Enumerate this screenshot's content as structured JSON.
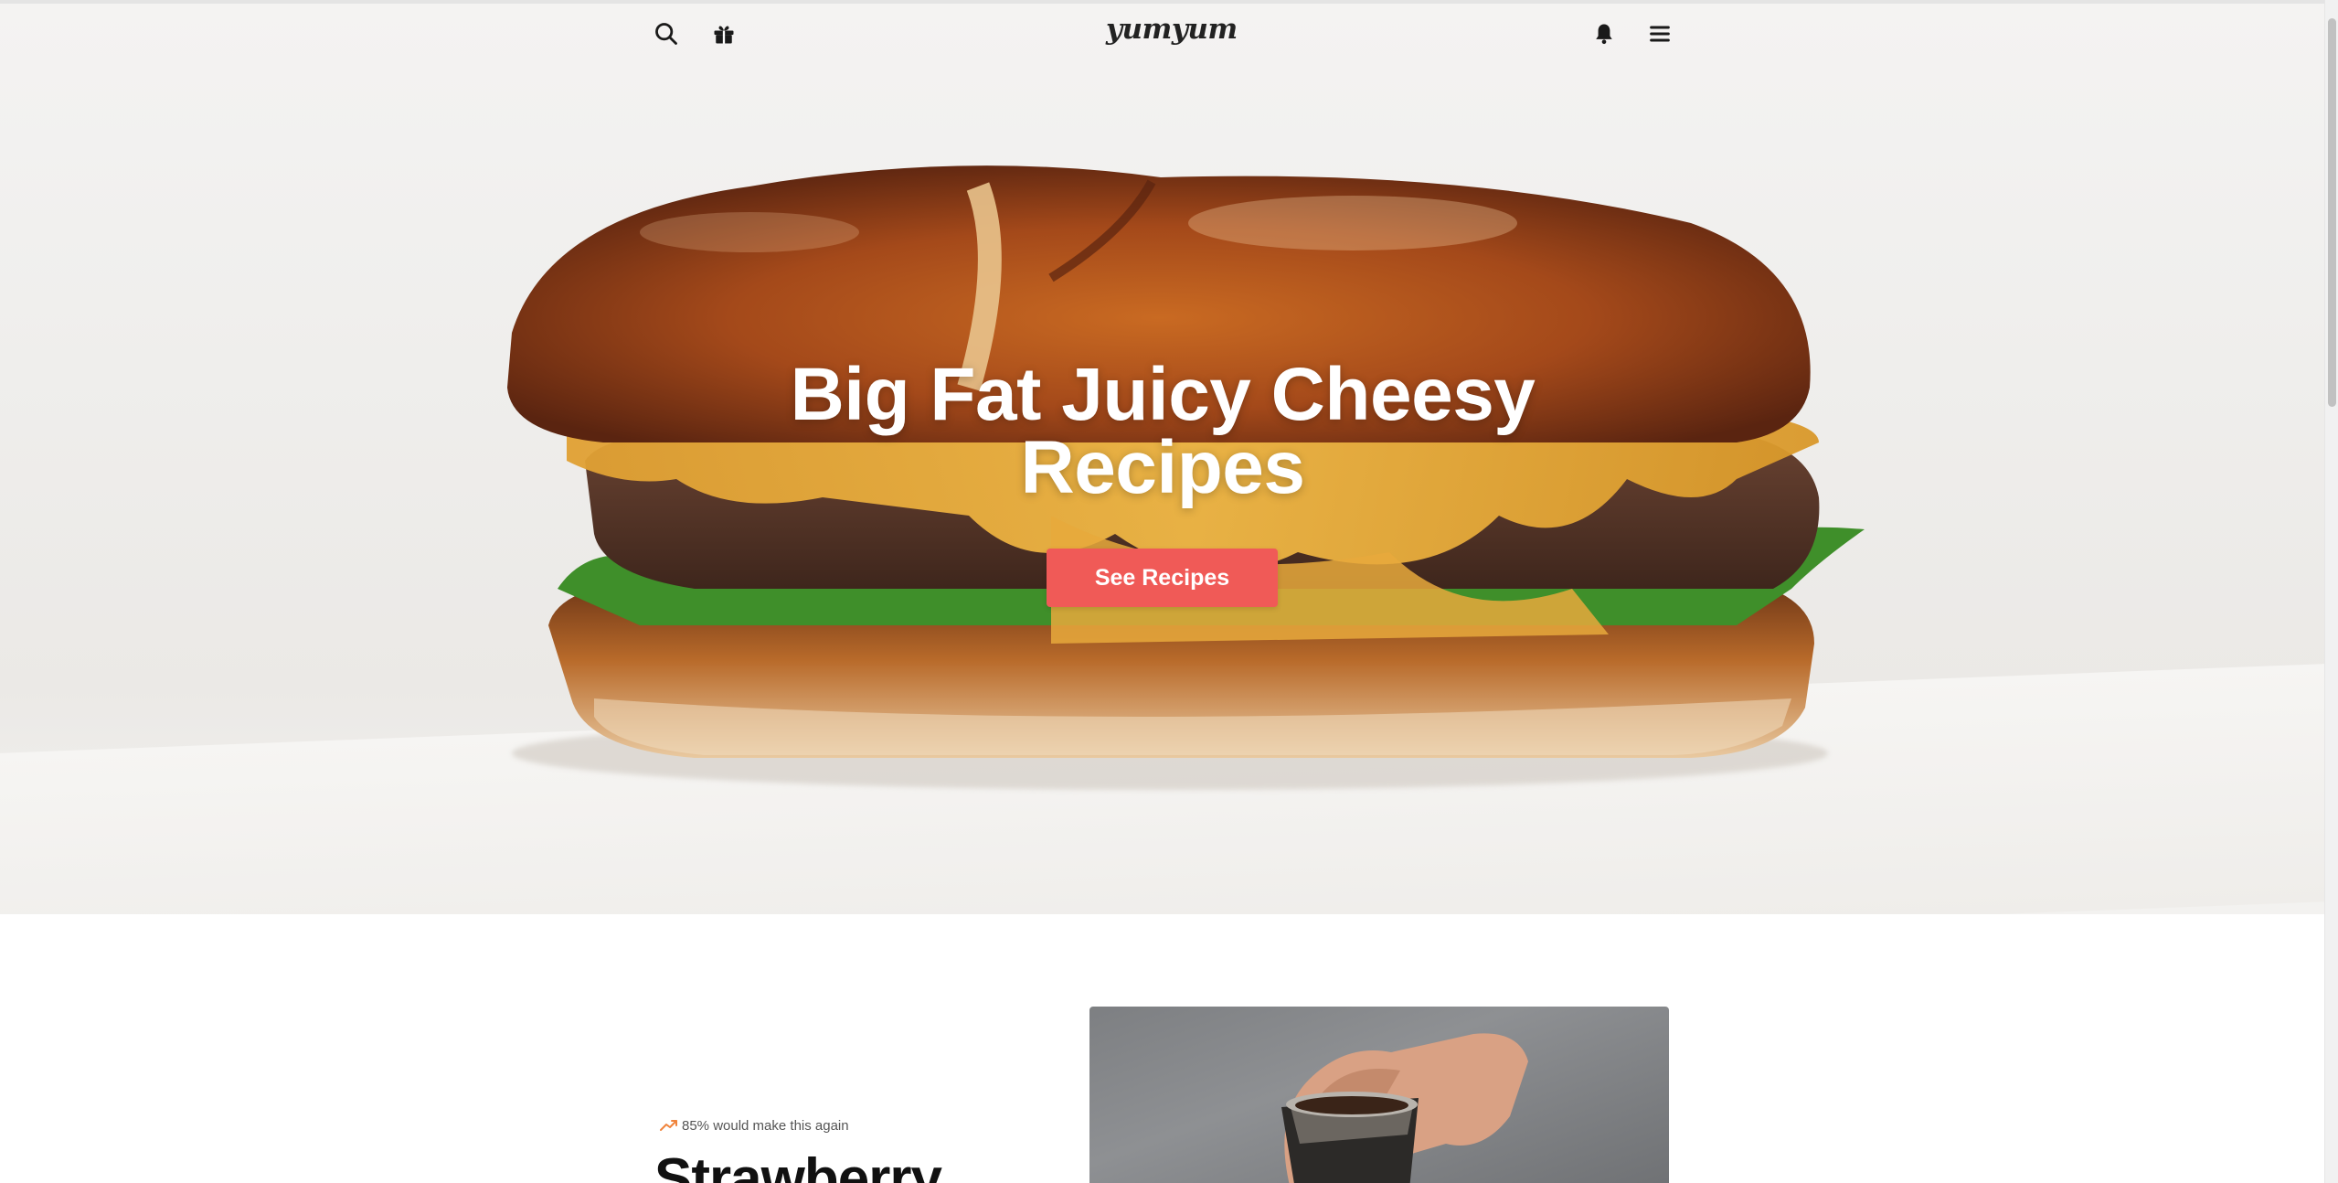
{
  "nav": {
    "logo": "yumyum",
    "icons": [
      "search-icon",
      "gift-icon",
      "bell-icon",
      "menu-icon"
    ]
  },
  "hero": {
    "title": "Big Fat Juicy Cheesy Recipes",
    "button_label": "See Recipes",
    "button_color": "#f05a57"
  },
  "featured": {
    "stat": "85% would make this again",
    "title": "Strawberry"
  }
}
